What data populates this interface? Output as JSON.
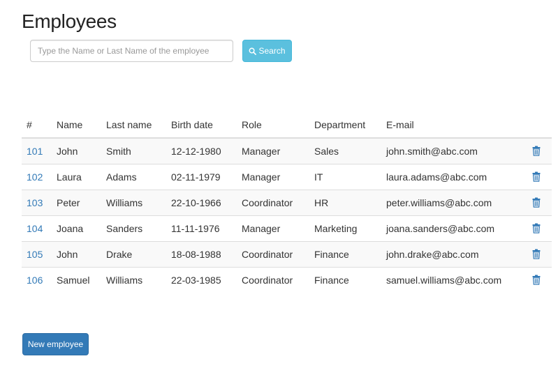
{
  "page": {
    "title": "Employees"
  },
  "search": {
    "placeholder": "Type the Name or Last Name of the employee",
    "value": "",
    "button_label": "Search",
    "button_icon": "search-icon"
  },
  "table": {
    "headers": [
      "#",
      "Name",
      "Last name",
      "Birth date",
      "Role",
      "Department",
      "E-mail"
    ],
    "rows": [
      {
        "id": "101",
        "name": "John",
        "last_name": "Smith",
        "birth_date": "12-12-1980",
        "role": "Manager",
        "department": "Sales",
        "email": "john.smith@abc.com"
      },
      {
        "id": "102",
        "name": "Laura",
        "last_name": "Adams",
        "birth_date": "02-11-1979",
        "role": "Manager",
        "department": "IT",
        "email": "laura.adams@abc.com"
      },
      {
        "id": "103",
        "name": "Peter",
        "last_name": "Williams",
        "birth_date": "22-10-1966",
        "role": "Coordinator",
        "department": "HR",
        "email": "peter.williams@abc.com"
      },
      {
        "id": "104",
        "name": "Joana",
        "last_name": "Sanders",
        "birth_date": "11-11-1976",
        "role": "Manager",
        "department": "Marketing",
        "email": "joana.sanders@abc.com"
      },
      {
        "id": "105",
        "name": "John",
        "last_name": "Drake",
        "birth_date": "18-08-1988",
        "role": "Coordinator",
        "department": "Finance",
        "email": "john.drake@abc.com"
      },
      {
        "id": "106",
        "name": "Samuel",
        "last_name": "Williams",
        "birth_date": "22-03-1985",
        "role": "Coordinator",
        "department": "Finance",
        "email": "samuel.williams@abc.com"
      }
    ],
    "delete_icon": "trash-icon"
  },
  "actions": {
    "new_employee_label": "New employee"
  },
  "colors": {
    "primary": "#337ab7",
    "info": "#5bc0de",
    "link": "#337ab7",
    "stripe": "#f9f9f9",
    "border": "#dddddd"
  }
}
